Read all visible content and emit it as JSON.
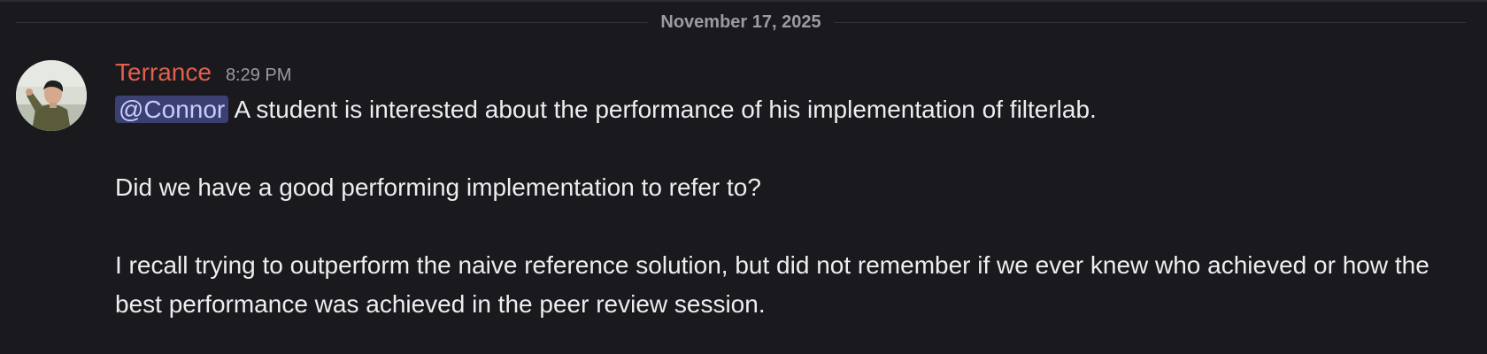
{
  "divider": {
    "date": "November 17, 2025"
  },
  "message": {
    "author": "Terrance",
    "time": "8:29 PM",
    "mention": "@Connor",
    "line1": "A student is interested about the performance of his implementation of filterlab.",
    "line2": "Did we have a good performing implementation to refer to?",
    "line3": "I recall trying to outperform the naive reference solution, but did not remember if we ever knew who achieved or how the best performance was achieved in the peer review session."
  },
  "colors": {
    "background": "#1a1a1e",
    "author": "#e35f4d",
    "mention_bg": "#3b3f72",
    "mention_text": "#c9cdfb"
  }
}
